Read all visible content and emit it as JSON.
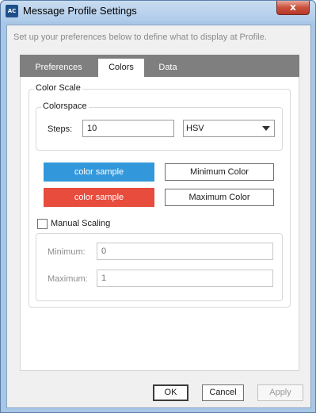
{
  "window": {
    "title": "Message Profile Settings",
    "app_icon_text": "AC",
    "close_glyph": "x"
  },
  "intro_text": "Set up your preferences below to define what to display at Profile.",
  "tabs": [
    {
      "label": "Preferences",
      "active": false
    },
    {
      "label": "Colors",
      "active": true
    },
    {
      "label": "Data",
      "active": false
    }
  ],
  "color_scale": {
    "legend": "Color Scale",
    "colorspace": {
      "legend": "Colorspace",
      "steps_label": "Steps:",
      "steps_value": "10",
      "mode_value": "HSV"
    },
    "min_sample": {
      "label": "color sample",
      "color": "#3398db"
    },
    "max_sample": {
      "label": "color sample",
      "color": "#e84c3d"
    },
    "min_button": "Minimum Color",
    "max_button": "Maximum Color",
    "manual_scaling": {
      "label": "Manual Scaling",
      "checked": false,
      "minimum_label": "Minimum:",
      "minimum_placeholder": "0",
      "maximum_label": "Maximum:",
      "maximum_placeholder": "1"
    }
  },
  "buttons": {
    "ok": "OK",
    "cancel": "Cancel",
    "apply": "Apply"
  },
  "icons": {
    "app": "app-logo-icon",
    "close": "close-icon",
    "dropdown": "chevron-down-icon"
  }
}
